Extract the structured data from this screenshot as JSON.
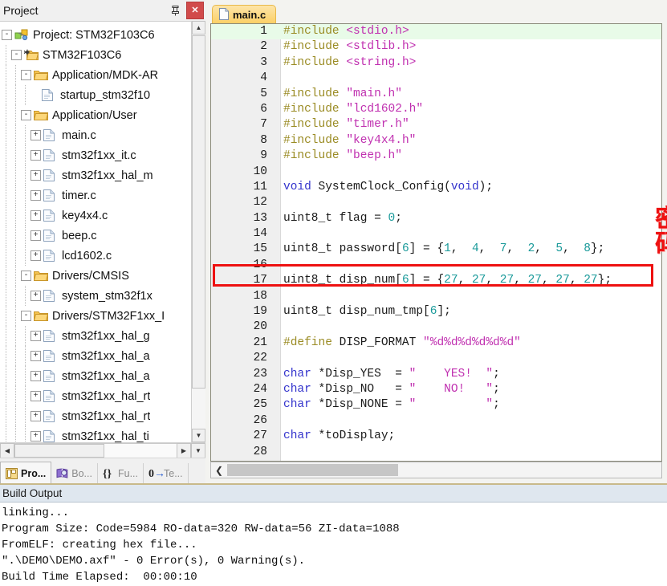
{
  "project_panel": {
    "title": "Project",
    "pin_icon": "pin-icon",
    "close_icon": "close-icon",
    "tree": [
      {
        "depth": 0,
        "expander": "-",
        "icon": "project-icon",
        "label": "Project: STM32F103C6"
      },
      {
        "depth": 1,
        "expander": "-",
        "icon": "target-icon",
        "label": "STM32F103C6"
      },
      {
        "depth": 2,
        "expander": "-",
        "icon": "folder-icon",
        "label": "Application/MDK-AR"
      },
      {
        "depth": 3,
        "expander": "",
        "icon": "file-icon",
        "label": "startup_stm32f10"
      },
      {
        "depth": 2,
        "expander": "-",
        "icon": "folder-icon",
        "label": "Application/User"
      },
      {
        "depth": 3,
        "expander": "+",
        "icon": "file-icon",
        "label": "main.c"
      },
      {
        "depth": 3,
        "expander": "+",
        "icon": "file-icon",
        "label": "stm32f1xx_it.c"
      },
      {
        "depth": 3,
        "expander": "+",
        "icon": "file-icon",
        "label": "stm32f1xx_hal_m"
      },
      {
        "depth": 3,
        "expander": "+",
        "icon": "file-icon",
        "label": "timer.c"
      },
      {
        "depth": 3,
        "expander": "+",
        "icon": "file-icon",
        "label": "key4x4.c"
      },
      {
        "depth": 3,
        "expander": "+",
        "icon": "file-icon",
        "label": "beep.c"
      },
      {
        "depth": 3,
        "expander": "+",
        "icon": "file-icon",
        "label": "lcd1602.c"
      },
      {
        "depth": 2,
        "expander": "-",
        "icon": "folder-icon",
        "label": "Drivers/CMSIS"
      },
      {
        "depth": 3,
        "expander": "+",
        "icon": "file-icon",
        "label": "system_stm32f1x"
      },
      {
        "depth": 2,
        "expander": "-",
        "icon": "folder-icon",
        "label": "Drivers/STM32F1xx_I"
      },
      {
        "depth": 3,
        "expander": "+",
        "icon": "file-icon",
        "label": "stm32f1xx_hal_g"
      },
      {
        "depth": 3,
        "expander": "+",
        "icon": "file-icon",
        "label": "stm32f1xx_hal_a"
      },
      {
        "depth": 3,
        "expander": "+",
        "icon": "file-icon",
        "label": "stm32f1xx_hal_a"
      },
      {
        "depth": 3,
        "expander": "+",
        "icon": "file-icon",
        "label": "stm32f1xx_hal_rt"
      },
      {
        "depth": 3,
        "expander": "+",
        "icon": "file-icon",
        "label": "stm32f1xx_hal_rt"
      },
      {
        "depth": 3,
        "expander": "+",
        "icon": "file-icon",
        "label": "stm32f1xx_hal_ti"
      }
    ],
    "tabs": [
      {
        "icon": "project-window-icon",
        "label": "Pro...",
        "active": true
      },
      {
        "icon": "books-icon",
        "label": "Bo...",
        "active": false
      },
      {
        "icon": "functions-icon",
        "label": "Fu...",
        "active": false
      },
      {
        "icon": "templates-icon",
        "label": "Te...",
        "active": false
      }
    ]
  },
  "editor": {
    "tab": {
      "icon": "file-icon",
      "label": "main.c"
    },
    "current_line": 1,
    "lines": [
      {
        "n": "1",
        "tokens": [
          {
            "t": "#include ",
            "c": "pre"
          },
          {
            "t": "<stdio.h>",
            "c": "str"
          }
        ]
      },
      {
        "n": "2",
        "tokens": [
          {
            "t": "#include ",
            "c": "pre"
          },
          {
            "t": "<stdlib.h>",
            "c": "str"
          }
        ]
      },
      {
        "n": "3",
        "tokens": [
          {
            "t": "#include ",
            "c": "pre"
          },
          {
            "t": "<string.h>",
            "c": "str"
          }
        ]
      },
      {
        "n": "4",
        "tokens": []
      },
      {
        "n": "5",
        "tokens": [
          {
            "t": "#include ",
            "c": "pre"
          },
          {
            "t": "\"main.h\"",
            "c": "str"
          }
        ]
      },
      {
        "n": "6",
        "tokens": [
          {
            "t": "#include ",
            "c": "pre"
          },
          {
            "t": "\"lcd1602.h\"",
            "c": "str"
          }
        ]
      },
      {
        "n": "7",
        "tokens": [
          {
            "t": "#include ",
            "c": "pre"
          },
          {
            "t": "\"timer.h\"",
            "c": "str"
          }
        ]
      },
      {
        "n": "8",
        "tokens": [
          {
            "t": "#include ",
            "c": "pre"
          },
          {
            "t": "\"key4x4.h\"",
            "c": "str"
          }
        ]
      },
      {
        "n": "9",
        "tokens": [
          {
            "t": "#include ",
            "c": "pre"
          },
          {
            "t": "\"beep.h\"",
            "c": "str"
          }
        ]
      },
      {
        "n": "10",
        "tokens": []
      },
      {
        "n": "11",
        "tokens": [
          {
            "t": "void",
            "c": "kw"
          },
          {
            "t": " SystemClock_Config(",
            "c": "plain"
          },
          {
            "t": "void",
            "c": "kw"
          },
          {
            "t": ");",
            "c": "plain"
          }
        ]
      },
      {
        "n": "12",
        "tokens": []
      },
      {
        "n": "13",
        "tokens": [
          {
            "t": "uint8_t flag = ",
            "c": "plain"
          },
          {
            "t": "0",
            "c": "num"
          },
          {
            "t": ";",
            "c": "plain"
          }
        ]
      },
      {
        "n": "14",
        "tokens": []
      },
      {
        "n": "15",
        "tokens": [
          {
            "t": "uint8_t password[",
            "c": "plain"
          },
          {
            "t": "6",
            "c": "num"
          },
          {
            "t": "] = {",
            "c": "plain"
          },
          {
            "t": "1",
            "c": "num"
          },
          {
            "t": ",  ",
            "c": "plain"
          },
          {
            "t": "4",
            "c": "num"
          },
          {
            "t": ",  ",
            "c": "plain"
          },
          {
            "t": "7",
            "c": "num"
          },
          {
            "t": ",  ",
            "c": "plain"
          },
          {
            "t": "2",
            "c": "num"
          },
          {
            "t": ",  ",
            "c": "plain"
          },
          {
            "t": "5",
            "c": "num"
          },
          {
            "t": ",  ",
            "c": "plain"
          },
          {
            "t": "8",
            "c": "num"
          },
          {
            "t": "};",
            "c": "plain"
          }
        ]
      },
      {
        "n": "16",
        "tokens": []
      },
      {
        "n": "17",
        "tokens": [
          {
            "t": "uint8_t disp_num[",
            "c": "plain"
          },
          {
            "t": "6",
            "c": "num"
          },
          {
            "t": "] = {",
            "c": "plain"
          },
          {
            "t": "27",
            "c": "num"
          },
          {
            "t": ", ",
            "c": "plain"
          },
          {
            "t": "27",
            "c": "num"
          },
          {
            "t": ", ",
            "c": "plain"
          },
          {
            "t": "27",
            "c": "num"
          },
          {
            "t": ", ",
            "c": "plain"
          },
          {
            "t": "27",
            "c": "num"
          },
          {
            "t": ", ",
            "c": "plain"
          },
          {
            "t": "27",
            "c": "num"
          },
          {
            "t": ", ",
            "c": "plain"
          },
          {
            "t": "27",
            "c": "num"
          },
          {
            "t": "};",
            "c": "plain"
          }
        ]
      },
      {
        "n": "18",
        "tokens": []
      },
      {
        "n": "19",
        "tokens": [
          {
            "t": "uint8_t disp_num_tmp[",
            "c": "plain"
          },
          {
            "t": "6",
            "c": "num"
          },
          {
            "t": "];",
            "c": "plain"
          }
        ]
      },
      {
        "n": "20",
        "tokens": []
      },
      {
        "n": "21",
        "tokens": [
          {
            "t": "#define",
            "c": "pre"
          },
          {
            "t": " DISP_FORMAT ",
            "c": "plain"
          },
          {
            "t": "\"%d%d%d%d%d%d\"",
            "c": "str"
          }
        ]
      },
      {
        "n": "22",
        "tokens": []
      },
      {
        "n": "23",
        "tokens": [
          {
            "t": "char",
            "c": "kw"
          },
          {
            "t": " *Disp_YES  = ",
            "c": "plain"
          },
          {
            "t": "\"    YES!  \"",
            "c": "str"
          },
          {
            "t": ";",
            "c": "plain"
          }
        ]
      },
      {
        "n": "24",
        "tokens": [
          {
            "t": "char",
            "c": "kw"
          },
          {
            "t": " *Disp_NO   = ",
            "c": "plain"
          },
          {
            "t": "\"    NO!   \"",
            "c": "str"
          },
          {
            "t": ";",
            "c": "plain"
          }
        ]
      },
      {
        "n": "25",
        "tokens": [
          {
            "t": "char",
            "c": "kw"
          },
          {
            "t": " *Disp_NONE = ",
            "c": "plain"
          },
          {
            "t": "\"          \"",
            "c": "str"
          },
          {
            "t": ";",
            "c": "plain"
          }
        ]
      },
      {
        "n": "26",
        "tokens": []
      },
      {
        "n": "27",
        "tokens": [
          {
            "t": "char",
            "c": "kw"
          },
          {
            "t": " *toDisplay;",
            "c": "plain"
          }
        ]
      },
      {
        "n": "28",
        "tokens": []
      }
    ],
    "annotation": {
      "label": "密码",
      "color": "#ee1111",
      "highlighted_line": 15
    }
  },
  "build_output": {
    "title": "Build Output",
    "lines": [
      "linking...",
      "Program Size: Code=5984 RO-data=320 RW-data=56 ZI-data=1088",
      "FromELF: creating hex file...",
      "\".\\DEMO\\DEMO.axf\" - 0 Error(s), 0 Warning(s).",
      "Build Time Elapsed:  00:00:10"
    ]
  }
}
